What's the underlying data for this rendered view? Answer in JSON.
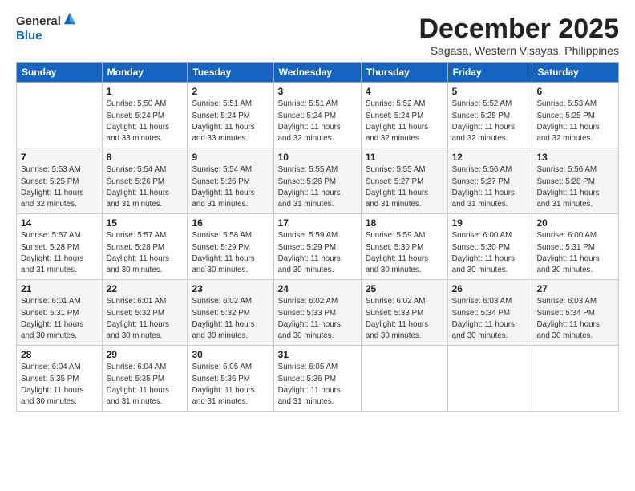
{
  "header": {
    "logo_line1": "General",
    "logo_line2": "Blue",
    "month_title": "December 2025",
    "subtitle": "Sagasa, Western Visayas, Philippines"
  },
  "weekdays": [
    "Sunday",
    "Monday",
    "Tuesday",
    "Wednesday",
    "Thursday",
    "Friday",
    "Saturday"
  ],
  "weeks": [
    [
      {
        "day": "",
        "info": ""
      },
      {
        "day": "1",
        "info": "Sunrise: 5:50 AM\nSunset: 5:24 PM\nDaylight: 11 hours\nand 33 minutes."
      },
      {
        "day": "2",
        "info": "Sunrise: 5:51 AM\nSunset: 5:24 PM\nDaylight: 11 hours\nand 33 minutes."
      },
      {
        "day": "3",
        "info": "Sunrise: 5:51 AM\nSunset: 5:24 PM\nDaylight: 11 hours\nand 32 minutes."
      },
      {
        "day": "4",
        "info": "Sunrise: 5:52 AM\nSunset: 5:24 PM\nDaylight: 11 hours\nand 32 minutes."
      },
      {
        "day": "5",
        "info": "Sunrise: 5:52 AM\nSunset: 5:25 PM\nDaylight: 11 hours\nand 32 minutes."
      },
      {
        "day": "6",
        "info": "Sunrise: 5:53 AM\nSunset: 5:25 PM\nDaylight: 11 hours\nand 32 minutes."
      }
    ],
    [
      {
        "day": "7",
        "info": "Sunrise: 5:53 AM\nSunset: 5:25 PM\nDaylight: 11 hours\nand 32 minutes."
      },
      {
        "day": "8",
        "info": "Sunrise: 5:54 AM\nSunset: 5:26 PM\nDaylight: 11 hours\nand 31 minutes."
      },
      {
        "day": "9",
        "info": "Sunrise: 5:54 AM\nSunset: 5:26 PM\nDaylight: 11 hours\nand 31 minutes."
      },
      {
        "day": "10",
        "info": "Sunrise: 5:55 AM\nSunset: 5:26 PM\nDaylight: 11 hours\nand 31 minutes."
      },
      {
        "day": "11",
        "info": "Sunrise: 5:55 AM\nSunset: 5:27 PM\nDaylight: 11 hours\nand 31 minutes."
      },
      {
        "day": "12",
        "info": "Sunrise: 5:56 AM\nSunset: 5:27 PM\nDaylight: 11 hours\nand 31 minutes."
      },
      {
        "day": "13",
        "info": "Sunrise: 5:56 AM\nSunset: 5:28 PM\nDaylight: 11 hours\nand 31 minutes."
      }
    ],
    [
      {
        "day": "14",
        "info": "Sunrise: 5:57 AM\nSunset: 5:28 PM\nDaylight: 11 hours\nand 31 minutes."
      },
      {
        "day": "15",
        "info": "Sunrise: 5:57 AM\nSunset: 5:28 PM\nDaylight: 11 hours\nand 30 minutes."
      },
      {
        "day": "16",
        "info": "Sunrise: 5:58 AM\nSunset: 5:29 PM\nDaylight: 11 hours\nand 30 minutes."
      },
      {
        "day": "17",
        "info": "Sunrise: 5:59 AM\nSunset: 5:29 PM\nDaylight: 11 hours\nand 30 minutes."
      },
      {
        "day": "18",
        "info": "Sunrise: 5:59 AM\nSunset: 5:30 PM\nDaylight: 11 hours\nand 30 minutes."
      },
      {
        "day": "19",
        "info": "Sunrise: 6:00 AM\nSunset: 5:30 PM\nDaylight: 11 hours\nand 30 minutes."
      },
      {
        "day": "20",
        "info": "Sunrise: 6:00 AM\nSunset: 5:31 PM\nDaylight: 11 hours\nand 30 minutes."
      }
    ],
    [
      {
        "day": "21",
        "info": "Sunrise: 6:01 AM\nSunset: 5:31 PM\nDaylight: 11 hours\nand 30 minutes."
      },
      {
        "day": "22",
        "info": "Sunrise: 6:01 AM\nSunset: 5:32 PM\nDaylight: 11 hours\nand 30 minutes."
      },
      {
        "day": "23",
        "info": "Sunrise: 6:02 AM\nSunset: 5:32 PM\nDaylight: 11 hours\nand 30 minutes."
      },
      {
        "day": "24",
        "info": "Sunrise: 6:02 AM\nSunset: 5:33 PM\nDaylight: 11 hours\nand 30 minutes."
      },
      {
        "day": "25",
        "info": "Sunrise: 6:02 AM\nSunset: 5:33 PM\nDaylight: 11 hours\nand 30 minutes."
      },
      {
        "day": "26",
        "info": "Sunrise: 6:03 AM\nSunset: 5:34 PM\nDaylight: 11 hours\nand 30 minutes."
      },
      {
        "day": "27",
        "info": "Sunrise: 6:03 AM\nSunset: 5:34 PM\nDaylight: 11 hours\nand 30 minutes."
      }
    ],
    [
      {
        "day": "28",
        "info": "Sunrise: 6:04 AM\nSunset: 5:35 PM\nDaylight: 11 hours\nand 30 minutes."
      },
      {
        "day": "29",
        "info": "Sunrise: 6:04 AM\nSunset: 5:35 PM\nDaylight: 11 hours\nand 31 minutes."
      },
      {
        "day": "30",
        "info": "Sunrise: 6:05 AM\nSunset: 5:36 PM\nDaylight: 11 hours\nand 31 minutes."
      },
      {
        "day": "31",
        "info": "Sunrise: 6:05 AM\nSunset: 5:36 PM\nDaylight: 11 hours\nand 31 minutes."
      },
      {
        "day": "",
        "info": ""
      },
      {
        "day": "",
        "info": ""
      },
      {
        "day": "",
        "info": ""
      }
    ]
  ]
}
